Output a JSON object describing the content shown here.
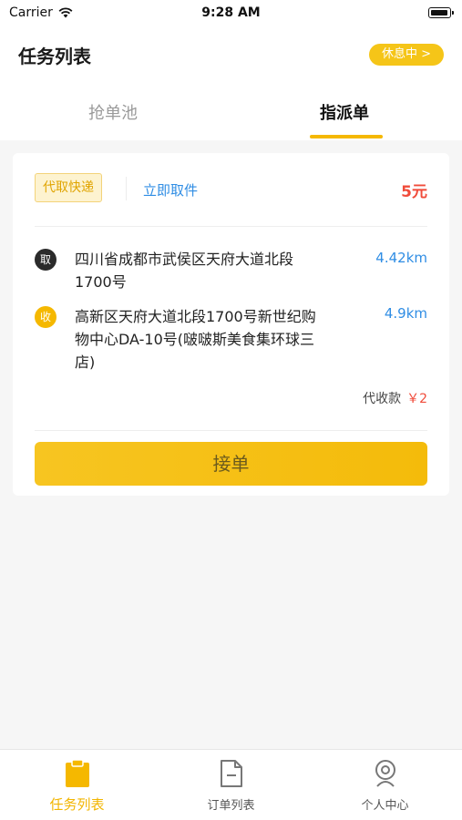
{
  "status": {
    "carrier": "Carrier",
    "time": "9:28 AM"
  },
  "header": {
    "title": "任务列表",
    "rest_button": "休息中 >"
  },
  "tabs": [
    {
      "label": "抢单池"
    },
    {
      "label": "指派单"
    }
  ],
  "order": {
    "type": "代取快递",
    "action": "立即取件",
    "price": "5元",
    "pickup": {
      "badge": "取",
      "address": "四川省成都市武侯区天府大道北段1700号",
      "distance": "4.42km"
    },
    "delivery": {
      "badge": "收",
      "address": "高新区天府大道北段1700号新世纪购物中心DA-10号(啵啵斯美食集环球三店)",
      "distance": "4.9km"
    },
    "cod_label": "代收款",
    "cod_amount": "￥2",
    "accept_button": "接单"
  },
  "tabbar": [
    {
      "label": "任务列表",
      "icon": "clipboard-icon"
    },
    {
      "label": "订单列表",
      "icon": "document-icon"
    },
    {
      "label": "个人中心",
      "icon": "person-icon"
    }
  ],
  "colors": {
    "accent": "#f5b800",
    "link": "#2f8de4",
    "price": "#f04b3a"
  }
}
